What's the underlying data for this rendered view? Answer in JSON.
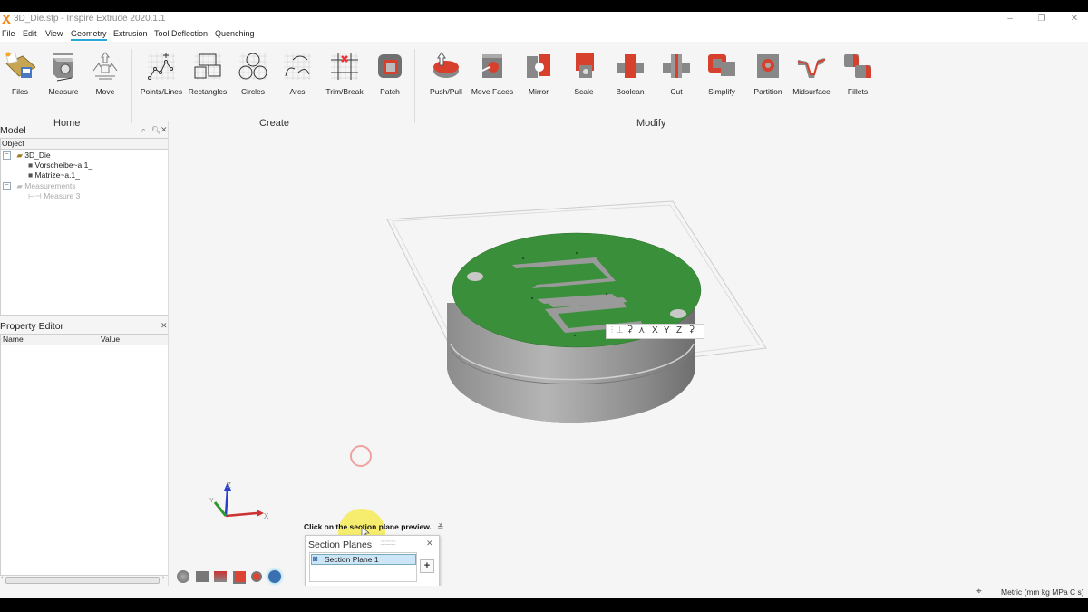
{
  "window": {
    "title": "3D_Die.stp - Inspire Extrude 2020.1.1",
    "controls": {
      "minimize": "–",
      "restore": "❐",
      "close": "✕"
    }
  },
  "menu": {
    "items": [
      {
        "label": "File"
      },
      {
        "label": "Edit"
      },
      {
        "label": "View"
      },
      {
        "label": "Geometry",
        "active": true
      },
      {
        "label": "Extrusion"
      },
      {
        "label": "Tool Deflection"
      },
      {
        "label": "Quenching"
      }
    ]
  },
  "ribbon": {
    "groups": [
      {
        "label": "Home",
        "tools": [
          {
            "label": "Files",
            "icon": "files-icon"
          },
          {
            "label": "Measure",
            "icon": "measure-icon"
          },
          {
            "label": "Move",
            "icon": "move-icon"
          }
        ]
      },
      {
        "label": "Create",
        "tools": [
          {
            "label": "Points/Lines",
            "icon": "points-lines-icon"
          },
          {
            "label": "Rectangles",
            "icon": "rectangles-icon"
          },
          {
            "label": "Circles",
            "icon": "circles-icon"
          },
          {
            "label": "Arcs",
            "icon": "arcs-icon"
          },
          {
            "label": "Trim/Break",
            "icon": "trim-break-icon"
          },
          {
            "label": "Patch",
            "icon": "patch-icon"
          }
        ]
      },
      {
        "label": "Modify",
        "tools": [
          {
            "label": "Push/Pull",
            "icon": "push-pull-icon"
          },
          {
            "label": "Move Faces",
            "icon": "move-faces-icon"
          },
          {
            "label": "Mirror",
            "icon": "mirror-icon"
          },
          {
            "label": "Scale",
            "icon": "scale-icon"
          },
          {
            "label": "Boolean",
            "icon": "boolean-icon"
          },
          {
            "label": "Cut",
            "icon": "cut-icon"
          },
          {
            "label": "Simplify",
            "icon": "simplify-icon"
          },
          {
            "label": "Partition",
            "icon": "partition-icon"
          },
          {
            "label": "Midsurface",
            "icon": "midsurface-icon"
          },
          {
            "label": "Fillets",
            "icon": "fillets-icon"
          }
        ]
      }
    ]
  },
  "model_browser": {
    "title": "Model",
    "column": "Object",
    "tree": [
      {
        "label": "3D_Die",
        "level": 0,
        "expander": "⊟",
        "icon": "assembly-icon"
      },
      {
        "label": "Vorscheibe~a.1_",
        "level": 1,
        "icon": "part-icon"
      },
      {
        "label": "Matrize~a.1_",
        "level": 1,
        "icon": "part-icon"
      },
      {
        "label": "Measurements",
        "level": 0,
        "expander": "⊟",
        "icon": "folder-icon",
        "dim": true
      },
      {
        "label": "Measure 3",
        "level": 1,
        "icon": "measure-line-icon",
        "dim": true
      }
    ]
  },
  "property_editor": {
    "title": "Property Editor",
    "columns": [
      "Name",
      "Value"
    ]
  },
  "viewport": {
    "section_toolbar": [
      "X",
      "Y",
      "Z"
    ],
    "triad": {
      "x": "X",
      "y": "Y",
      "z": "Z"
    },
    "colors": {
      "top_face": "#3a8f3a",
      "body": "#9a9a9a",
      "accent": "#2aa6d6"
    }
  },
  "hint": {
    "text": "Click on the section plane preview."
  },
  "section_planes": {
    "title": "Section Planes",
    "items": [
      {
        "label": "Section Plane 1",
        "selected": true
      }
    ],
    "add_label": "+",
    "close": "✕"
  },
  "status": {
    "units": "Metric (mm kg MPa C s)"
  }
}
